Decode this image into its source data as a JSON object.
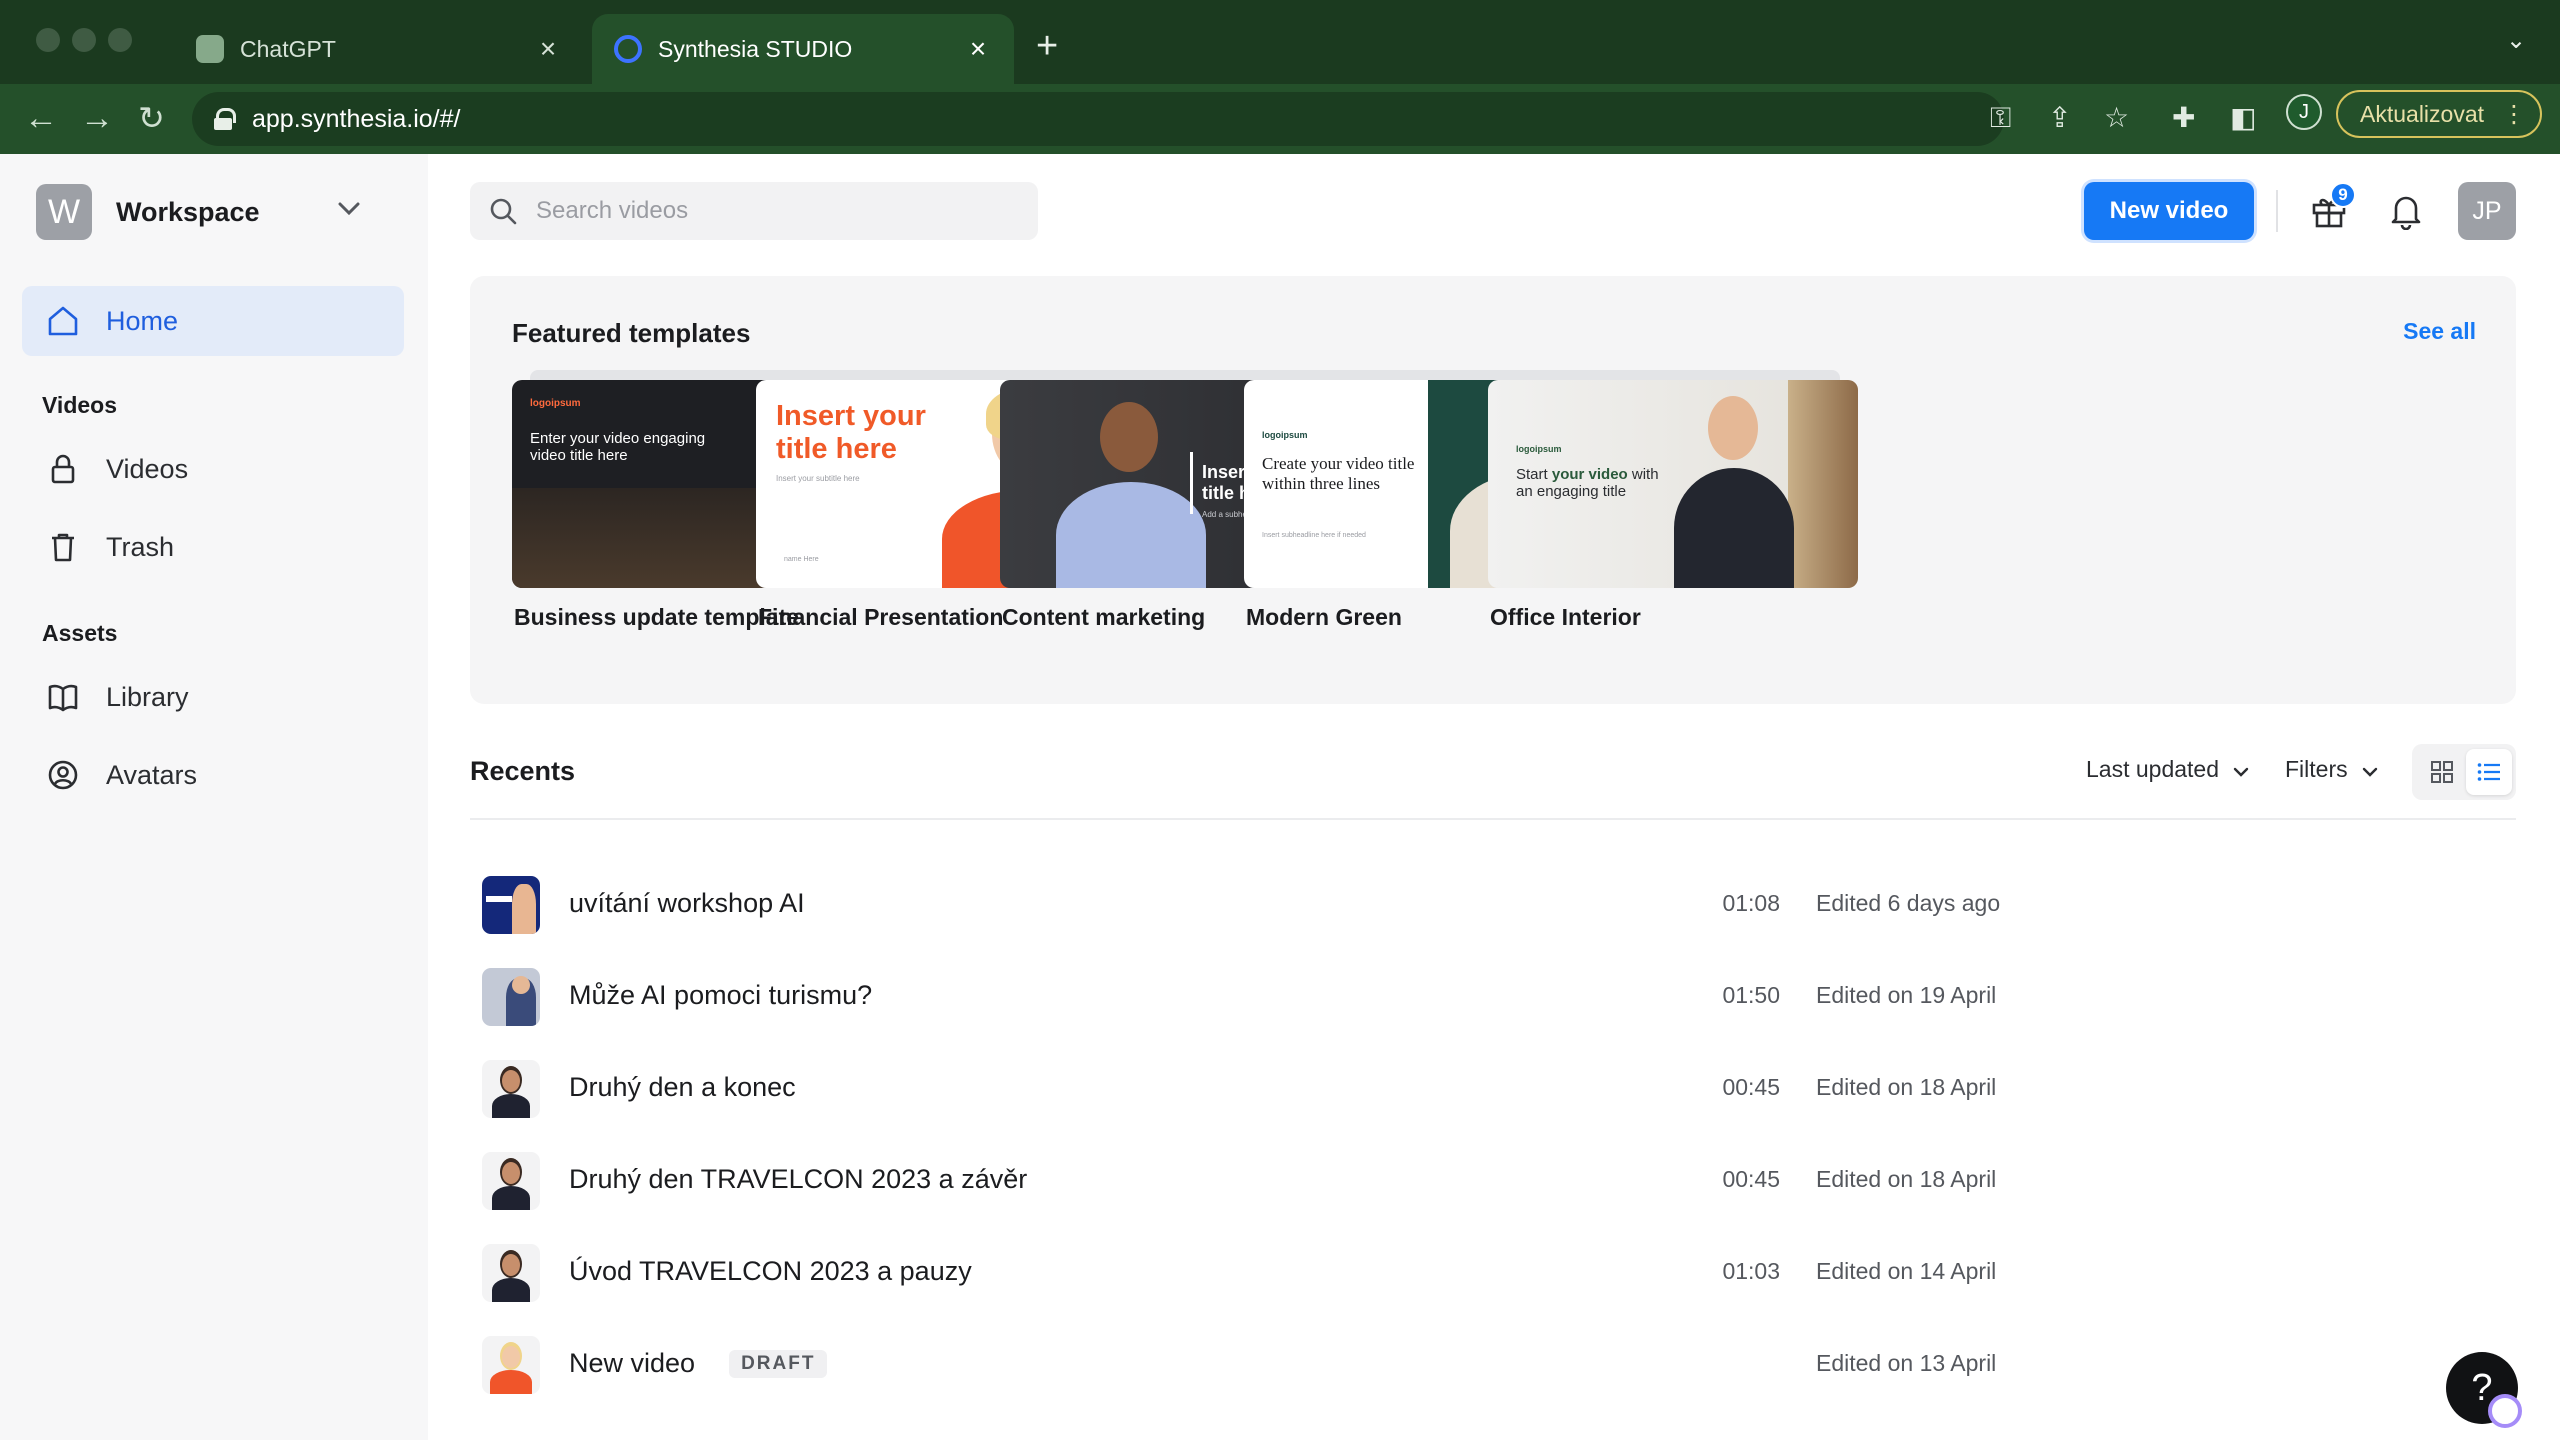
{
  "browser": {
    "tabs": [
      {
        "title": "ChatGPT",
        "active": false
      },
      {
        "title": "Synthesia STUDIO",
        "active": true
      }
    ],
    "new_tab": "+",
    "url": "app.synthesia.io/#/",
    "profile_initial": "J",
    "update_label": "Aktualizovat",
    "tab_close": "×"
  },
  "sidebar": {
    "workspace_initial": "W",
    "workspace_name": "Workspace",
    "home": "Home",
    "videos_heading": "Videos",
    "videos": "Videos",
    "trash": "Trash",
    "assets_heading": "Assets",
    "library": "Library",
    "avatars": "Avatars"
  },
  "header": {
    "search_placeholder": "Search videos",
    "new_video": "New video",
    "gift_badge": "9",
    "user_initials": "JP"
  },
  "featured": {
    "title": "Featured templates",
    "see_all": "See all",
    "templates": [
      {
        "name": "Business update template",
        "thumb_logo": "logoipsum",
        "thumb_text": "Enter your video engaging video title here"
      },
      {
        "name": "Financial Presentation",
        "thumb_text": "Insert your title here",
        "thumb_sub": "Insert your subtitle here",
        "thumb_foot": "name Here"
      },
      {
        "name": "Content marketing",
        "thumb_text": "Insert your video title here",
        "thumb_sub": "Add a subheading if needed here"
      },
      {
        "name": "Modern Green",
        "thumb_logo": "logoipsum",
        "thumb_text": "Create your video title within three lines",
        "thumb_sub": "Insert subheadline here if needed"
      },
      {
        "name": "Office Interior",
        "thumb_logo": "logoipsum",
        "thumb_text_pre": "Start ",
        "thumb_text_bold": "your video",
        "thumb_text_post": " with an engaging title"
      }
    ]
  },
  "recents": {
    "title": "Recents",
    "sort_label": "Last updated",
    "filters_label": "Filters",
    "items": [
      {
        "title": "uvítání workshop AI",
        "duration": "01:08",
        "edited": "Edited 6 days ago",
        "draft": ""
      },
      {
        "title": "Může AI pomoci turismu?",
        "duration": "01:50",
        "edited": "Edited on 19 April",
        "draft": ""
      },
      {
        "title": "Druhý den a konec",
        "duration": "00:45",
        "edited": "Edited on 18 April",
        "draft": ""
      },
      {
        "title": "Druhý den TRAVELCON 2023 a závěr",
        "duration": "00:45",
        "edited": "Edited on 18 April",
        "draft": ""
      },
      {
        "title": "Úvod TRAVELCON 2023 a pauzy",
        "duration": "01:03",
        "edited": "Edited on 14 April",
        "draft": ""
      },
      {
        "title": "New video",
        "duration": "",
        "edited": "Edited on 13 April",
        "draft": "DRAFT"
      }
    ]
  },
  "help": "?",
  "colors": {
    "accent": "#1679f5",
    "chrome": "#24502a",
    "home_active_bg": "#e3ebf9"
  }
}
